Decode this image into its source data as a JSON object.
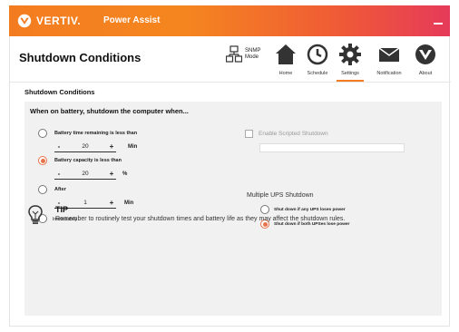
{
  "titlebar": {
    "brand": "VERTIV.",
    "app_name": "Power Assist"
  },
  "header": {
    "title": "Shutdown Conditions",
    "snmp_label": "SNMP\nMode"
  },
  "nav": {
    "items": [
      {
        "label": "Home",
        "icon": "home-icon"
      },
      {
        "label": "Schedule",
        "icon": "clock-icon"
      },
      {
        "label": "Settings",
        "icon": "gear-icon",
        "active": true
      },
      {
        "label": "Notification",
        "icon": "envelope-icon"
      },
      {
        "label": "About",
        "icon": "vertiv-logo-icon"
      }
    ]
  },
  "section": {
    "title": "Shutdown Conditions",
    "heading": "When on battery, shutdown the computer when..."
  },
  "options": {
    "battery_time": {
      "label": "Battery time remaining is less than",
      "value": "20",
      "unit": "Min",
      "checked": false
    },
    "battery_capacity": {
      "label": "Battery capacity is less than",
      "value": "20",
      "unit": "%",
      "checked": true
    },
    "after": {
      "label": "After",
      "value": "1",
      "unit": "Min",
      "checked": false
    },
    "immediately": {
      "label": "Immediately",
      "checked": false
    }
  },
  "stepper": {
    "minus": "-",
    "plus": "+"
  },
  "scripted": {
    "label": "Enable Scripted Shutdown",
    "checked": false,
    "value": ""
  },
  "ups": {
    "title": "Multiple UPS Shutdown",
    "any": {
      "label": "Shut down if any UPS loses power",
      "checked": false
    },
    "both": {
      "label": "Shut down if both UPSes lose power",
      "checked": true
    }
  },
  "tip": {
    "title": "TIP",
    "text": "Remember to routinely test your shutdown times and battery life as they may affect the shutdown rules."
  },
  "colors": {
    "accent": "#f47c20",
    "radio_checked": "#e8734a"
  }
}
